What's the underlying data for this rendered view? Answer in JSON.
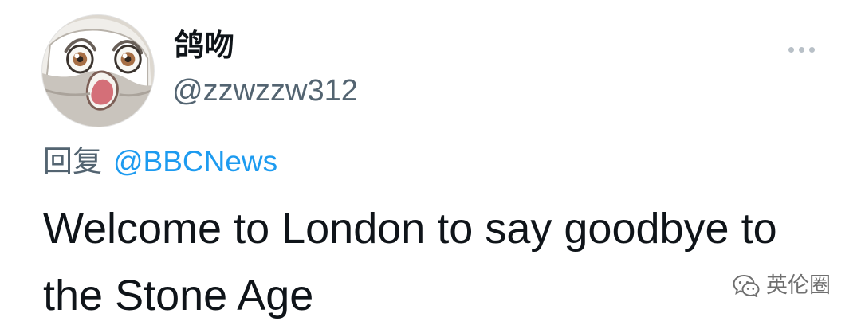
{
  "tweet": {
    "author": {
      "display_name": "鸽吻",
      "handle": "@zzwzzw312",
      "avatar_icon": "cartoon-avatar-icon"
    },
    "menu": {
      "icon": "more-options-icon"
    },
    "reply_to": {
      "prefix": "回复",
      "mention": "@BBCNews"
    },
    "text": "Welcome to London to say goodbye to the Stone Age"
  },
  "watermark": {
    "icon": "wechat-logo-icon",
    "text": "英伦圈"
  },
  "colors": {
    "background": "#ffffff",
    "primary_text": "#0f1419",
    "secondary_text": "#536471",
    "link": "#1d9bf0",
    "menu_dots": "#b8c0c7"
  }
}
